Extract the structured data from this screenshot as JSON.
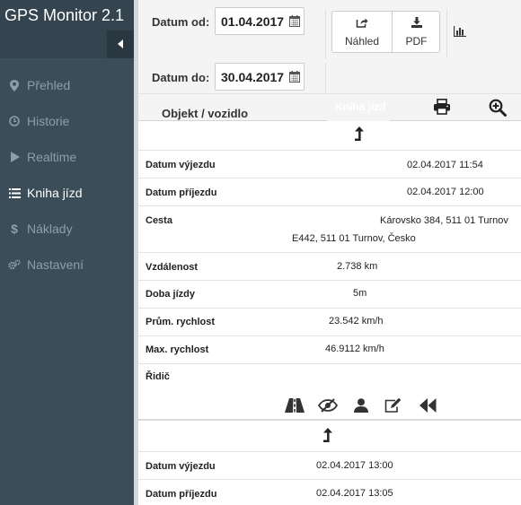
{
  "app": {
    "title": "GPS Monitor 2.1"
  },
  "sidebar": {
    "items": [
      {
        "label": "Přehled",
        "icon": "map-marker-icon",
        "active": false
      },
      {
        "label": "Historie",
        "icon": "clock-icon",
        "active": false
      },
      {
        "label": "Realtime",
        "icon": "play-icon",
        "active": false
      },
      {
        "label": "Kniha jízd",
        "icon": "list-icon",
        "active": true
      },
      {
        "label": "Náklady",
        "icon": "dollar-icon",
        "active": false
      },
      {
        "label": "Nastavení",
        "icon": "gears-icon",
        "active": false
      }
    ]
  },
  "filter": {
    "from_label": "Datum od:",
    "from_value": "01.04.2017",
    "to_label": "Datum do:",
    "to_value": "30.04.2017",
    "preview_label": "Náhled",
    "pdf_label": "PDF"
  },
  "table": {
    "col_object": "Objekt / vozidlo",
    "col_book": "Kniha jízd"
  },
  "trip1": {
    "depart_label": "Datum výjezdu",
    "depart_value": "02.04.2017 11:54",
    "arrive_label": "Datum příjezdu",
    "arrive_value": "02.04.2017 12:00",
    "route_label": "Cesta",
    "route_line1": "Károvsko 384, 511 01 Turnov",
    "route_line2": "E442, 511 01 Turnov, Česko",
    "distance_label": "Vzdálenost",
    "distance_value": "2.738 km",
    "duration_label": "Doba jízdy",
    "duration_value": "5m",
    "avg_label": "Prům. rychlost",
    "avg_value": "23.542 km/h",
    "max_label": "Max. rychlost",
    "max_value": "46.9112 km/h",
    "driver_label": "Řidič"
  },
  "trip2": {
    "depart_label": "Datum výjezdu",
    "depart_value": "02.04.2017 13:00",
    "arrive_label": "Datum příjezdu",
    "arrive_value": "02.04.2017 13:05"
  },
  "colors": {
    "sidebar_bg": "#3b4d58",
    "sidebar_text": "#8e9ea8",
    "active_text": "#ffffff"
  }
}
